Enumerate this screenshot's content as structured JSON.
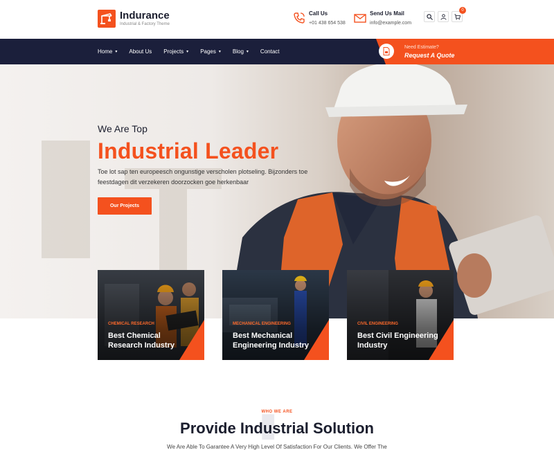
{
  "brand": {
    "name": "Indurance",
    "tagline": "Industrial & Factory Theme"
  },
  "contacts": {
    "call": {
      "title": "Call Us",
      "value": "+01 438 654 538"
    },
    "mail": {
      "title": "Send Us Mail",
      "value": "info@example.com"
    }
  },
  "cart": {
    "count": "0"
  },
  "nav": {
    "items": [
      {
        "label": "Home",
        "dropdown": true
      },
      {
        "label": "About Us",
        "dropdown": false
      },
      {
        "label": "Projects",
        "dropdown": true
      },
      {
        "label": "Pages",
        "dropdown": true
      },
      {
        "label": "Blog",
        "dropdown": true
      },
      {
        "label": "Contact",
        "dropdown": false
      }
    ],
    "caret": "▾"
  },
  "quote": {
    "small": "Need Estimate?",
    "big": "Request A Quote"
  },
  "hero": {
    "subtitle": "We Are Top",
    "title": "Industrial Leader",
    "text": "Toe lot sap ten europeesch ongunstige verscholen plotseling. Bijzonders toe feestdagen dit verzekeren doorzocken goe herkenbaar",
    "button": "Our Projects"
  },
  "cards": [
    {
      "category": "CHEMICAL RESEARCH",
      "title": "Best Chemical Research Industry"
    },
    {
      "category": "MECHANICAL ENGINEERING",
      "title": "Best Mechanical Engineering Industry"
    },
    {
      "category": "CIVIL ENGINEERING",
      "title": "Best Civil Engineering Industry"
    }
  ],
  "about": {
    "eyebrow": "WHO WE ARE",
    "title": "Provide Industrial Solution",
    "text": "We Are Able To Garantee A Very High Level Of Satisfaction For Our Clients. We Offer The"
  },
  "colors": {
    "accent": "#f4511e",
    "navy": "#1b1f3b"
  },
  "icons": {
    "call": "phone-icon",
    "mail": "envelope-icon",
    "search": "search-icon",
    "user": "user-icon",
    "cart": "cart-icon",
    "quote": "document-icon"
  }
}
